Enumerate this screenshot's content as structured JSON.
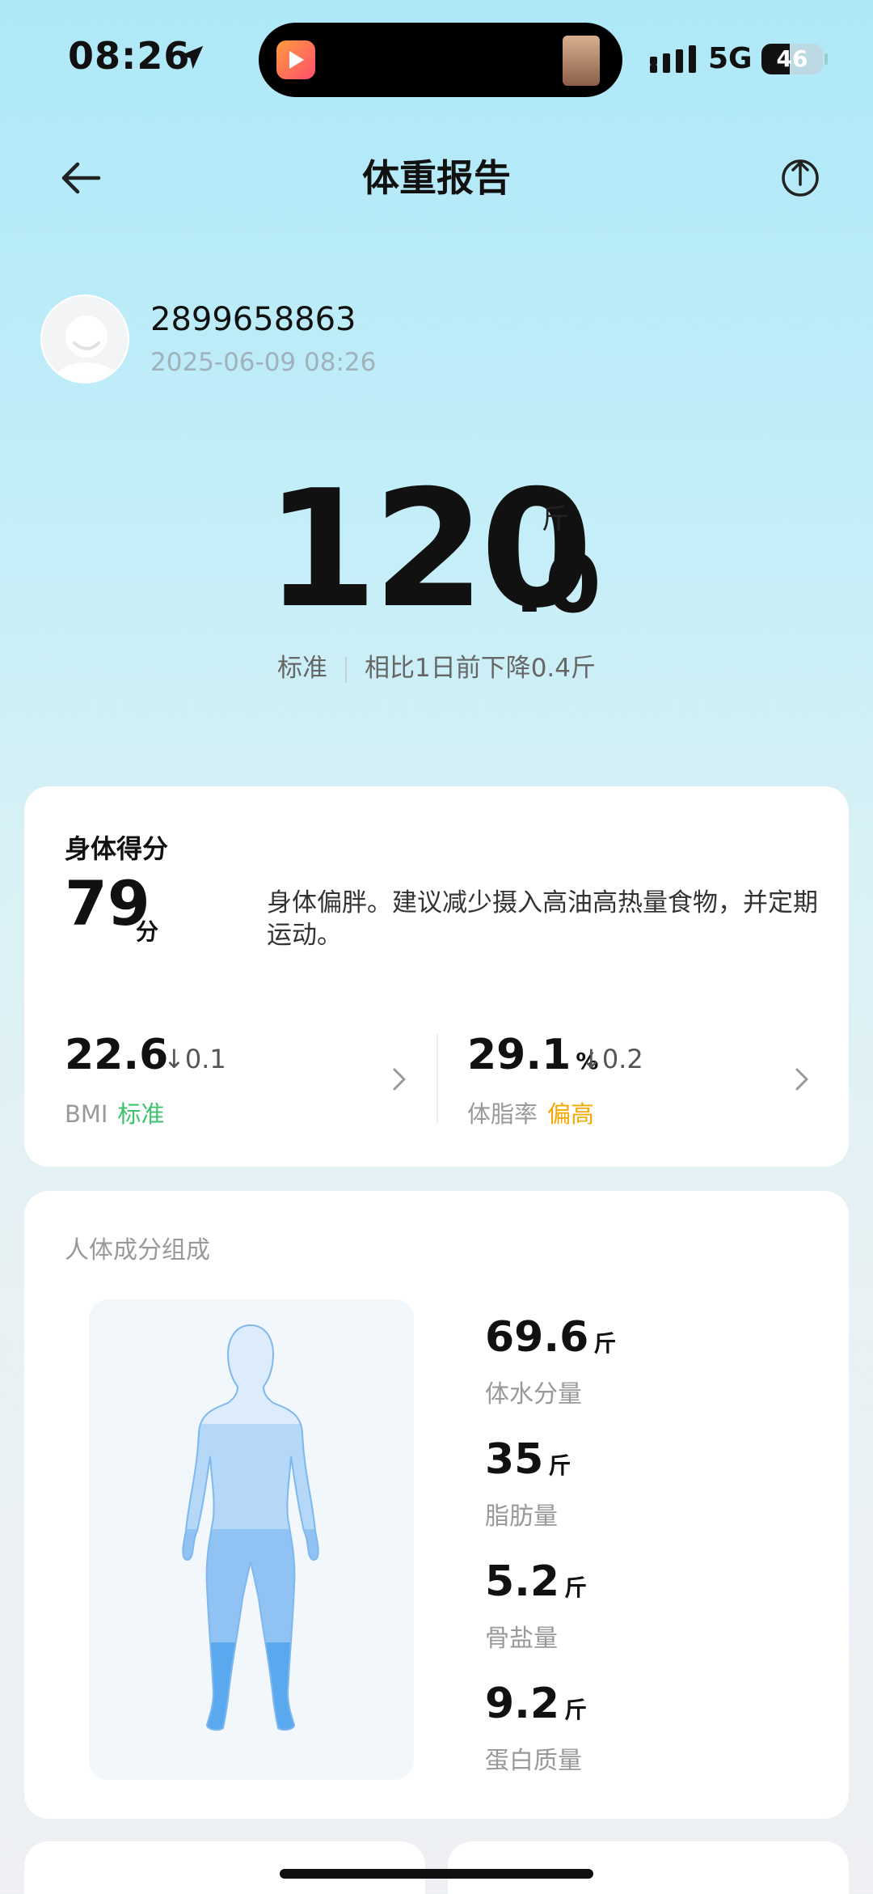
{
  "status_bar": {
    "time": "08:26",
    "network": "5G",
    "battery_level": 46,
    "battery_text": "46"
  },
  "header": {
    "title": "体重报告"
  },
  "user": {
    "id": "2899658863",
    "datetime": "2025-06-09 08:26"
  },
  "weight": {
    "integer": "120",
    "decimal": ".0",
    "unit": "斤",
    "status": "标准",
    "comparison": "相比1日前下降0.4斤"
  },
  "score_card": {
    "title": "身体得分",
    "score": "79",
    "score_unit": "分",
    "description": "身体偏胖。建议减少摄入高油高热量食物，并定期运动。",
    "bmi": {
      "value": "22.6",
      "delta": "↓0.1",
      "label": "BMI",
      "status": "标准",
      "status_color": "#3cc36b"
    },
    "body_fat": {
      "value": "29.1",
      "unit": "%",
      "delta": "↓0.2",
      "label": "体脂率",
      "status": "偏高",
      "status_color": "#f5a800"
    }
  },
  "composition_card": {
    "title": "人体成分组成",
    "items": [
      {
        "value": "69.6",
        "unit": "斤",
        "label": "体水分量"
      },
      {
        "value": "35",
        "unit": "斤",
        "label": "脂肪量"
      },
      {
        "value": "5.2",
        "unit": "斤",
        "label": "骨盐量"
      },
      {
        "value": "9.2",
        "unit": "斤",
        "label": "蛋白质量"
      }
    ]
  },
  "colors": {
    "accent_blue": "#5aa8ee",
    "status_green": "#3cc36b",
    "status_orange": "#f5a800"
  },
  "icons": [
    "location-arrow-icon",
    "back-arrow-icon",
    "share-icon",
    "chevron-right-icon",
    "avatar-icon",
    "signal-icon",
    "battery-icon"
  ]
}
